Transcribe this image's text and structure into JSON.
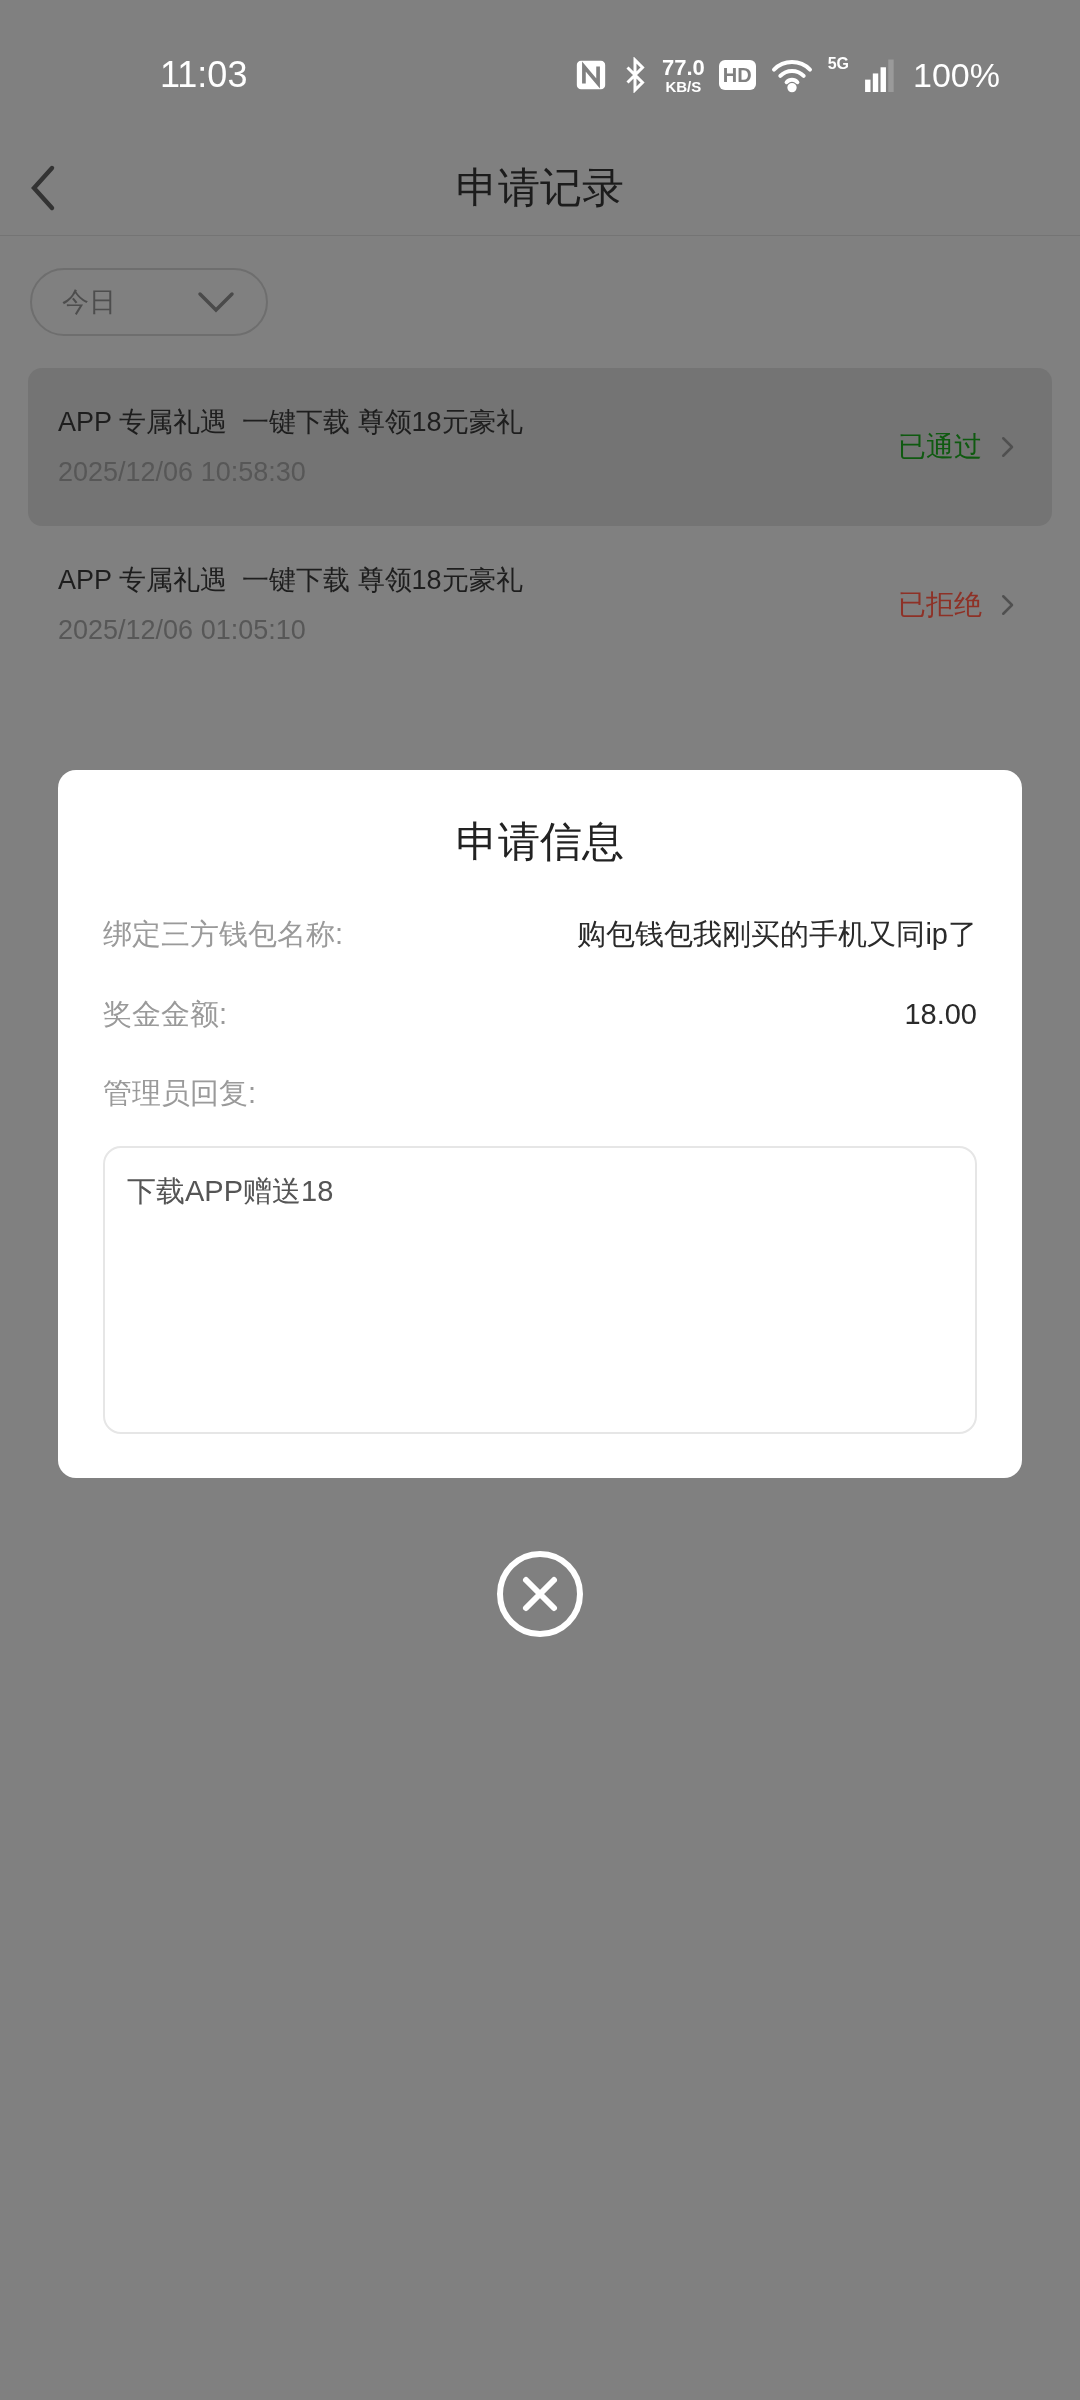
{
  "status_bar": {
    "time": "11:03",
    "speed": "77.0",
    "speed_unit": "KB/S",
    "hd": "HD",
    "network": "5G",
    "battery": "100%"
  },
  "header": {
    "title": "申请记录"
  },
  "filter": {
    "value": "今日"
  },
  "records": [
    {
      "title": "APP 专属礼遇  一键下载 尊领18元豪礼",
      "time": "2025/12/06 10:58:30",
      "status": "已通过",
      "color": "#0f5a10",
      "selected": true
    },
    {
      "title": "APP 专属礼遇  一键下载 尊领18元豪礼",
      "time": "2025/12/06 01:05:10",
      "status": "已拒绝",
      "color": "#8e3126",
      "selected": false
    }
  ],
  "dialog": {
    "title": "申请信息",
    "fields": [
      {
        "label": "绑定三方钱包名称:",
        "value": "购包钱包我刚买的手机又同ip了"
      },
      {
        "label": "奖金金额:",
        "value": "18.00"
      }
    ],
    "reply_label": "管理员回复:",
    "reply": "下载APP赠送18"
  }
}
